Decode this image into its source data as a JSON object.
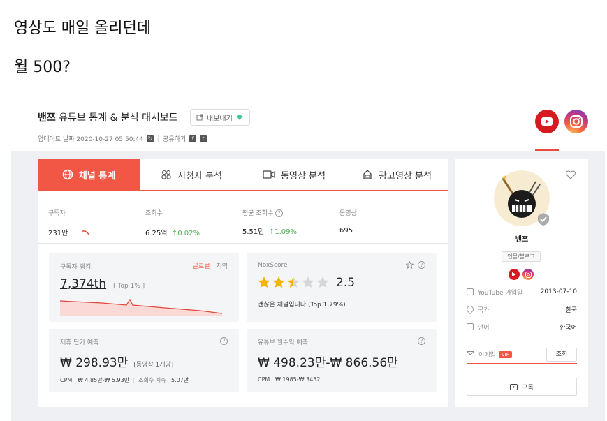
{
  "caption": {
    "line1": "영상도 매일 올리던데",
    "line2": "월 500?"
  },
  "header": {
    "title_name": "밴쯔",
    "title_rest": " 유튜브 통계 & 분석 대시보드",
    "export_label": "내보내기",
    "update_label": "업데이트 날짜 2020-10-27 05:50:44",
    "share_label": "공유하기"
  },
  "tabs": [
    {
      "label": "채널 통계",
      "icon": "globe-icon"
    },
    {
      "label": "시청자 분석",
      "icon": "users-icon"
    },
    {
      "label": "동영상 분석",
      "icon": "video-icon"
    },
    {
      "label": "광고영상 분석",
      "icon": "ad-icon"
    }
  ],
  "stats": [
    {
      "label": "구독자",
      "value": "231만",
      "change": ""
    },
    {
      "label": "조회수",
      "value": "6.25억",
      "change": "0.02%"
    },
    {
      "label": "평균 조회수",
      "value": "5.51만",
      "change": "1.09%"
    },
    {
      "label": "동영상",
      "value": "695",
      "change": ""
    }
  ],
  "ranking": {
    "label": "구독자 랭킹",
    "global": "글로벌",
    "region": "지역",
    "value": "7,374th",
    "top": "[ Top 1% ]"
  },
  "nox": {
    "label": "NoxScore",
    "score": "2.5",
    "rating": 2.5,
    "desc": "괜찮은 채널입니다 (Top 1.79%)"
  },
  "collab": {
    "label": "제휴 단가 예측",
    "value": "₩ 298.93만",
    "note": "[동영상 1개당]",
    "cpm_label": "CPM",
    "cpm_value": "₩ 4.85만-₩ 5.93만",
    "views_label": "조회수 예측",
    "views_value": "5.07만"
  },
  "revenue": {
    "label": "유튜브 월수익 예측",
    "value": "₩ 498.23만-₩ 866.56만",
    "cpm_label": "CPM",
    "cpm_value": "₩ 1985-₩ 3452"
  },
  "profile": {
    "name": "밴쯔",
    "category": "인물/블로그",
    "rows": [
      {
        "label": "YouTube 가입일",
        "value": "2013-07-10"
      },
      {
        "label": "국가",
        "value": "한국"
      },
      {
        "label": "언어",
        "value": "한국어"
      }
    ],
    "email_label": "이메일",
    "vip": "VIP",
    "lookup_label": "조회",
    "subscribe_label": "구독"
  },
  "colors": {
    "accent": "#f25645",
    "youtube": "#d71920",
    "green": "#4caf50"
  }
}
